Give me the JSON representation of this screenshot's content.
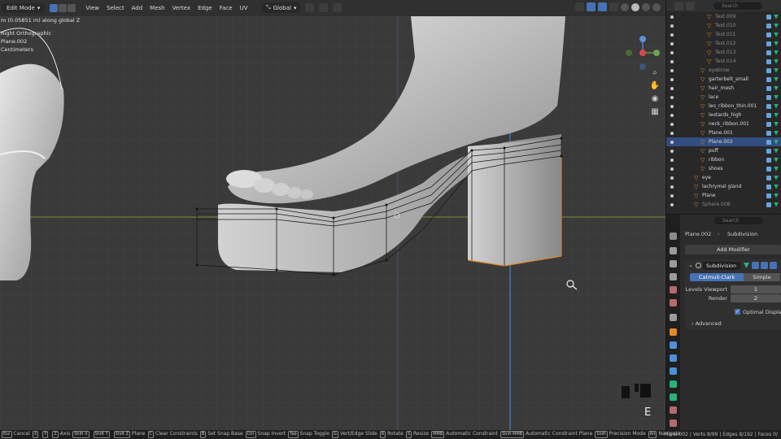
{
  "header": {
    "mode": "Edit Mode",
    "menu": [
      "View",
      "Select",
      "Add",
      "Mesh",
      "Vertex",
      "Edge",
      "Face",
      "UV"
    ],
    "orientation": "Global"
  },
  "viewport": {
    "transform_info": "m (0.05851 m) along global Z",
    "view_name": "Right Orthographic",
    "object_name": "Plane.002",
    "units": "Centimeters",
    "key_overlay": "E"
  },
  "outliner": {
    "search_placeholder": "Search",
    "rows": [
      {
        "label": "Text.009",
        "dim": true
      },
      {
        "label": "Text.010",
        "dim": true
      },
      {
        "label": "Text.011",
        "dim": true
      },
      {
        "label": "Text.012",
        "dim": true
      },
      {
        "label": "Text.013",
        "dim": true
      },
      {
        "label": "Text.014",
        "dim": true
      },
      {
        "label": "eyebrow",
        "dim": true
      },
      {
        "label": "garterbelt_small",
        "dim": false
      },
      {
        "label": "hair_mesh",
        "dim": false
      },
      {
        "label": "lace",
        "dim": false
      },
      {
        "label": "leo_ribbon_thin.001",
        "dim": false
      },
      {
        "label": "leotards_high",
        "dim": false
      },
      {
        "label": "neck_ribbon.001",
        "dim": false
      },
      {
        "label": "Plane.001",
        "dim": false
      },
      {
        "label": "Plane.002",
        "dim": false
      },
      {
        "label": "puff",
        "dim": false
      },
      {
        "label": "ribbon",
        "dim": false
      },
      {
        "label": "shoes",
        "dim": false
      },
      {
        "label": "eye",
        "dim": false
      },
      {
        "label": "lachrymal gland",
        "dim": false
      },
      {
        "label": "Plane",
        "dim": false
      },
      {
        "label": "Sphere.008",
        "dim": true
      }
    ]
  },
  "properties": {
    "search_placeholder": "Search",
    "object": "Plane.002",
    "modifier_context": "Subdivision",
    "add_modifier": "Add Modifier",
    "modifier_name": "Subdivision",
    "mode_options": [
      "Catmull-Clark",
      "Simple"
    ],
    "levels_viewport_label": "Levels Viewport",
    "levels_viewport": "1",
    "render_label": "Render",
    "render": "2",
    "optimal_display": "Optimal Display",
    "advanced": "Advanced"
  },
  "statusbar": {
    "items": [
      {
        "key": "Esc",
        "label": "Cancel"
      },
      {
        "key": "X",
        "label": ""
      },
      {
        "key": "Y",
        "label": ""
      },
      {
        "key": "Z",
        "label": "Axis"
      },
      {
        "key": "Shift X",
        "label": ""
      },
      {
        "key": "Shift Y",
        "label": ""
      },
      {
        "key": "Shift Z",
        "label": "Plane"
      },
      {
        "key": "C",
        "label": "Clear Constraints"
      },
      {
        "key": "B",
        "label": "Set Snap Base"
      },
      {
        "key": "Ctrl",
        "label": "Snap Invert"
      },
      {
        "key": "Tab",
        "label": "Snap Toggle"
      },
      {
        "key": "G",
        "label": "Vert/Edge Slide"
      },
      {
        "key": "R",
        "label": "Rotate"
      },
      {
        "key": "S",
        "label": "Resize"
      },
      {
        "key": "MMB",
        "label": "Automatic Constraint"
      },
      {
        "key": "Shift MMB",
        "label": "Automatic Constraint Plane"
      },
      {
        "key": "Shift",
        "label": "Precision Mode"
      },
      {
        "key": "Alt",
        "label": "Navigate"
      }
    ],
    "stats": "Plane.002 | Verts 8/99 | Edges 8/192 | Faces 0/"
  }
}
